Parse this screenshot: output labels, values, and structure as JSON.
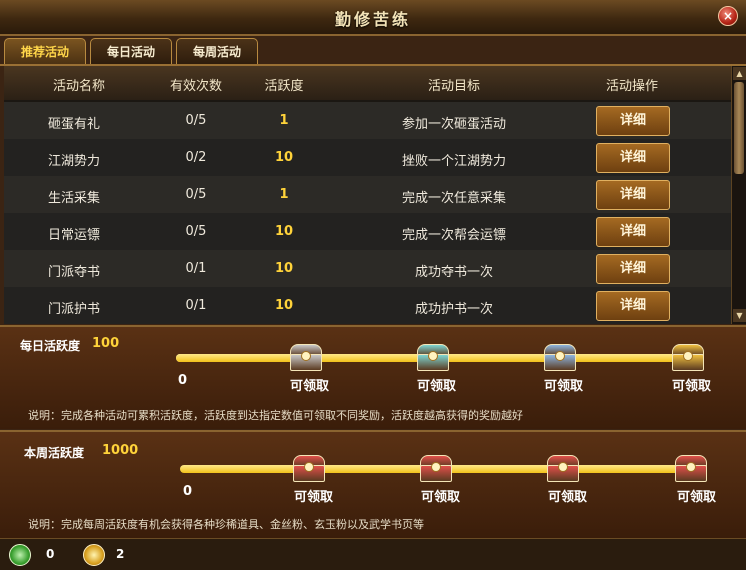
{
  "window": {
    "title": "勤修苦练"
  },
  "tabs": [
    {
      "label": "推荐活动"
    },
    {
      "label": "每日活动"
    },
    {
      "label": "每周活动"
    }
  ],
  "table": {
    "headers": [
      "活动名称",
      "有效次数",
      "活跃度",
      "活动目标",
      "活动操作"
    ],
    "button_label": "详细",
    "rows": [
      {
        "name": "砸蛋有礼",
        "count": "0/5",
        "points": "1",
        "goal": "参加一次砸蛋活动"
      },
      {
        "name": "江湖势力",
        "count": "0/2",
        "points": "10",
        "goal": "挫败一个江湖势力"
      },
      {
        "name": "生活采集",
        "count": "0/5",
        "points": "1",
        "goal": "完成一次任意采集"
      },
      {
        "name": "日常运镖",
        "count": "0/5",
        "points": "10",
        "goal": "完成一次帮会运镖"
      },
      {
        "name": "门派夺书",
        "count": "0/1",
        "points": "10",
        "goal": "成功夺书一次"
      },
      {
        "name": "门派护书",
        "count": "0/1",
        "points": "10",
        "goal": "成功护书一次"
      }
    ]
  },
  "daily": {
    "label": "每日活跃度",
    "value": "100",
    "start": "0",
    "claim_label": "可领取",
    "chest_colors": [
      "#c9c9c9",
      "#7fd6d2",
      "#8fb6e0",
      "#f0c040"
    ],
    "note": "说明：完成各种活动可累积活跃度，活跃度到达指定数值可领取不同奖励，活跃度越高获得的奖励越好"
  },
  "weekly": {
    "label": "本周活跃度",
    "value": "1000",
    "start": "0",
    "claim_label": "可领取",
    "chest_colors": [
      "#e0504a",
      "#e0504a",
      "#e0504a",
      "#e0504a"
    ],
    "note": "说明：完成每周活跃度有机会获得各种珍稀道具、金丝粉、玄玉粉以及武学书页等"
  },
  "currency": [
    {
      "icon": "jade-coin-icon",
      "count": "0"
    },
    {
      "icon": "gold-coin-icon",
      "count": "2"
    }
  ]
}
